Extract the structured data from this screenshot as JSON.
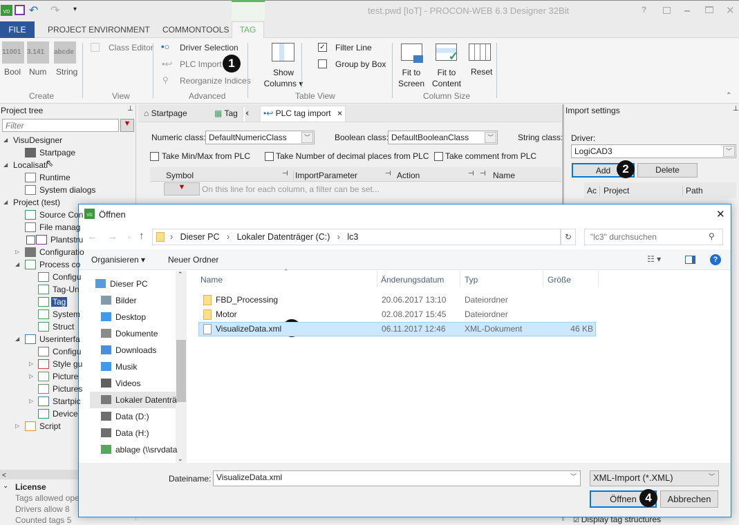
{
  "app": {
    "title": "test.pwd [IoT] - PROCON-WEB 6.3 Designer 32Bit",
    "logo": "VD",
    "window_controls": [
      "?",
      "restore-icon",
      "minimize-icon",
      "maximize-icon",
      "close-icon"
    ]
  },
  "ribbon": {
    "tabs": [
      {
        "label": "FILE"
      },
      {
        "label": "PROJECT ENVIRONMENT"
      },
      {
        "label": "COMMONTOOLS"
      },
      {
        "label": "TAG",
        "active": true
      }
    ],
    "create": {
      "group": "Create",
      "items": [
        {
          "tile": "11001",
          "label": "Bool"
        },
        {
          "tile": "3.141",
          "label": "Num"
        },
        {
          "tile": "abcde",
          "label": "String"
        }
      ]
    },
    "view": {
      "group": "View",
      "class_editor": "Class Editor"
    },
    "advanced": {
      "group": "Advanced",
      "driver_selection": "Driver Selection",
      "plc_import": "PLC Import",
      "reorganize": "Reorganize Indices"
    },
    "table_view": {
      "group": "Table View",
      "show": "Show",
      "columns": "Columns",
      "filter_line": "Filter Line",
      "filter_line_checked": true,
      "group_by_box": "Group by Box",
      "group_by_box_checked": false
    },
    "column_size": {
      "group": "Column Size",
      "fit_screen_1": "Fit to",
      "fit_screen_2": "Screen",
      "fit_content_1": "Fit to",
      "fit_content_2": "Content",
      "reset": "Reset"
    }
  },
  "project_tree": {
    "title": "Project tree",
    "filter_placeholder": "Filter",
    "items": [
      "VisuDesigner",
      "Startpage",
      "Localisati",
      "Runtime",
      "System dialogs",
      "Project (test)",
      "Source Con",
      "File manag",
      "Plantstru",
      "Configuratio",
      "Process co",
      "Configu",
      "Tag-Un",
      "Tag",
      "System",
      "Struct",
      "Userinterfa",
      "Configu",
      "Style gu",
      "Picture",
      "Pictures",
      "Startpic",
      "Device",
      "Script"
    ],
    "selected": "Tag"
  },
  "license": {
    "title": "License",
    "lines": [
      "Tags allowed oper",
      "Drivers allow 8",
      "Counted tags 5"
    ]
  },
  "doc_tabs": [
    {
      "label": "Startpage"
    },
    {
      "label": "Tag",
      "close": "×"
    },
    {
      "label": "PLC tag import",
      "close": "×",
      "active": true
    }
  ],
  "plc_import": {
    "numeric_label": "Numeric class:",
    "numeric_value": "DefaultNumericClass",
    "boolean_label": "Boolean class:",
    "boolean_value": "DefaultBooleanClass",
    "string_label": "String class:",
    "take_minmax": "Take Min/Max from PLC",
    "take_decimals": "Take Number of decimal places from PLC",
    "take_comment": "Take comment from PLC",
    "columns": [
      "Symbol",
      "ImportParameter",
      "Action",
      "Name"
    ],
    "filter_hint": "On this line for each column, a filter can be set..."
  },
  "import_settings": {
    "title": "Import settings",
    "driver_label": "Driver:",
    "driver_value": "LogiCAD3",
    "add": "Add",
    "delete": "Delete",
    "columns": [
      "Ac",
      "Project",
      "Path"
    ],
    "display_tag_structures": "Display tag structures"
  },
  "dialog": {
    "title": "Öffnen",
    "breadcrumb": [
      "Dieser PC",
      "Lokaler Datenträger (C:)",
      "lc3"
    ],
    "search_placeholder": "\"lc3\" durchsuchen",
    "organize": "Organisieren",
    "new_folder": "Neuer Ordner",
    "nav": [
      "Dieser PC",
      "Bilder",
      "Desktop",
      "Dokumente",
      "Downloads",
      "Musik",
      "Videos",
      "Lokaler Datenträ",
      "Data (D:)",
      "Data (H:)",
      "ablage (\\\\srvdata"
    ],
    "nav_selected": "Lokaler Datenträ",
    "columns": [
      "Name",
      "Änderungsdatum",
      "Typ",
      "Größe"
    ],
    "files": [
      {
        "name": "FBD_Processing",
        "date": "20.06.2017 13:10",
        "type": "Dateiordner",
        "size": "",
        "kind": "folder"
      },
      {
        "name": "Motor",
        "date": "02.08.2017 15:45",
        "type": "Dateiordner",
        "size": "",
        "kind": "folder"
      },
      {
        "name": "VisualizeData.xml",
        "date": "06.11.2017 12:46",
        "type": "XML-Dokument",
        "size": "46 KB",
        "kind": "file",
        "selected": true
      }
    ],
    "filename_label": "Dateiname:",
    "filename_value": "VisualizeData.xml",
    "filter_value": "XML-Import (*.XML)",
    "open": "Öffnen",
    "cancel": "Abbrechen"
  },
  "badges": [
    "1",
    "2",
    "3",
    "4"
  ],
  "colors": {
    "file_tab": "#2b579a",
    "tag_tab": "#5cb85c",
    "selection": "#cce8ff",
    "tree_selection": "#2b579a",
    "badge": "#111111"
  }
}
